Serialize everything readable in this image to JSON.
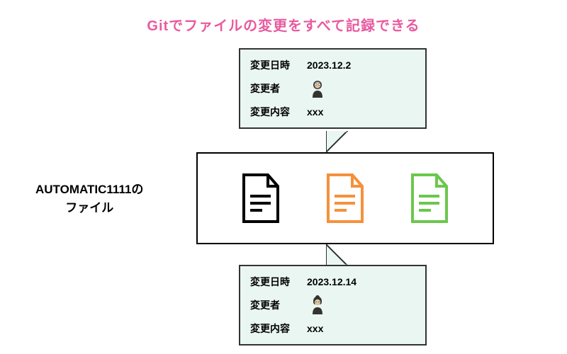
{
  "title": "Gitでファイルの変更をすべて記録できる",
  "label_line1": "AUTOMATIC1111の",
  "label_line2": "ファイル",
  "bubbles": {
    "top": {
      "date_label": "変更日時",
      "date_value": "2023.12.2",
      "author_label": "変更者",
      "content_label": "変更内容",
      "content_value": "xxx"
    },
    "bottom": {
      "date_label": "変更日時",
      "date_value": "2023.12.14",
      "author_label": "変更者",
      "content_label": "変更内容",
      "content_value": "xxx"
    }
  },
  "files": {
    "file1_color": "#000000",
    "file2_color": "#f5913c",
    "file3_color": "#6bc74d"
  }
}
